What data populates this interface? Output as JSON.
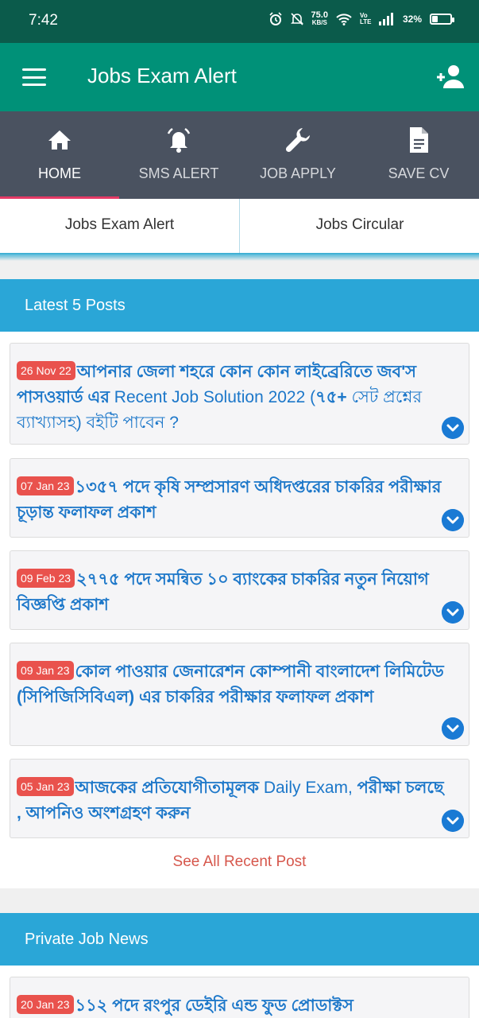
{
  "status_bar": {
    "time": "7:42",
    "net_speed_value": "75.0",
    "net_speed_unit": "KB/S",
    "volte_label": "Vo LTE",
    "battery_percent": "32%",
    "battery_level": 0.32
  },
  "app_bar": {
    "title": "Jobs Exam Alert",
    "menu_icon": "hamburger-menu-icon",
    "action_icon": "add-user-icon"
  },
  "nav": {
    "items": [
      {
        "label": "HOME",
        "icon": "home-icon",
        "active": true
      },
      {
        "label": "SMS ALERT",
        "icon": "bell-icon",
        "active": false
      },
      {
        "label": "JOB APPLY",
        "icon": "wrench-icon",
        "active": false
      },
      {
        "label": "SAVE CV",
        "icon": "document-icon",
        "active": false
      }
    ]
  },
  "tabs": [
    {
      "label": "Jobs Exam Alert",
      "selected": true
    },
    {
      "label": "Jobs Circular",
      "selected": false
    }
  ],
  "latest_section": {
    "title": "Latest 5 Posts",
    "posts": [
      {
        "date": "26 Nov 22",
        "title_parts": [
          "আপনার জেলা শহরে কোন কোন লাইব্রেরিতে জব'স পাসওয়ার্ড এর",
          " Recent Job Solution 2022 (",
          "৭৫+",
          " সেট প্রশ্নের ব্যাখ্যাসহ) বইটি পাবেন ?"
        ]
      },
      {
        "date": "07 Jan 23",
        "title_parts": [
          "১৩৫৭ পদে কৃষি সম্প্রসারণ অধিদপ্তরের চাকরির পরীক্ষার চূড়ান্ত ফলাফল প্রকাশ"
        ]
      },
      {
        "date": "09 Feb 23",
        "title_parts": [
          "২৭৭৫ পদে সমন্বিত ১০ ব্যাংকের চাকরির নতুন নিয়োগ বিজ্ঞপ্তি প্রকাশ"
        ]
      },
      {
        "date": "09 Jan 23",
        "title_parts": [
          "কোল পাওয়ার জেনারেশন কোম্পানী বাংলাদেশ লিমিটেড (সিপিজিসিবিএল) এর চাকরির পরীক্ষার ফলাফল প্রকাশ"
        ]
      },
      {
        "date": "05 Jan 23",
        "title_parts": [
          "আজকের প্রতিযোগীতামূলক",
          " Daily Exam,",
          " পরীক্ষা চলছে , আপনিও অংশগ্রহণ করুন"
        ]
      }
    ],
    "see_all_label": "See All Recent Post"
  },
  "private_section": {
    "title": "Private Job News",
    "posts": [
      {
        "date": "20 Jan 23",
        "title_parts": [
          "১১২ পদে রংপুর ডেইরি এন্ড ফুড প্রোডাক্টস"
        ]
      }
    ]
  },
  "colors": {
    "status_bar": "#0b5b4b",
    "app_bar": "#009178",
    "nav_bar": "#4a5260",
    "nav_active_underline": "#e53a66",
    "section_header": "#2aa6d7",
    "post_title": "#1c77c9",
    "date_badge": "#e9524d",
    "see_all": "#d6574c"
  }
}
